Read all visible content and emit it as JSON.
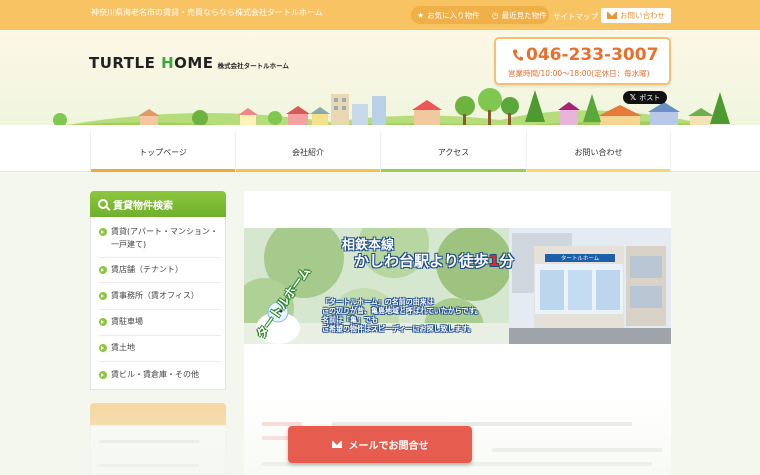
{
  "topbar": {
    "tagline": "神奈川県海老名市の賃貸・売買ならなら株式会社タートルホーム",
    "favorites_label": "お気に入り物件",
    "recent_label": "最近見た物件",
    "sitemap_label": "サイトマップ",
    "contact_label": "お問い合わせ"
  },
  "header": {
    "logo_main_a": "TURTLE ",
    "logo_main_h": "H",
    "logo_main_b": "OME",
    "logo_sub": "株式会社タートルホーム",
    "phone": "046-233-3007",
    "hours": "営業時間/10:00～18:00(定休日：毎水曜)",
    "x_post": "ポスト"
  },
  "nav": {
    "items": [
      {
        "label": "トップページ",
        "color": "#f0a93a"
      },
      {
        "label": "会社紹介",
        "color": "#f3c34a"
      },
      {
        "label": "アクセス",
        "color": "#9bcf4a"
      },
      {
        "label": "お問い合わせ",
        "color": "#f5d76a"
      }
    ]
  },
  "sidebar": {
    "title": "賃貸物件検索",
    "items": [
      {
        "label": "賃貸(アパート・マンション・一戸建て)"
      },
      {
        "label": "賃店舗（テナント）"
      },
      {
        "label": "賃事務所（賃オフィス）"
      },
      {
        "label": "賃駐車場"
      },
      {
        "label": "賃土地"
      },
      {
        "label": "賃ビル・賃倉庫・その他"
      }
    ]
  },
  "banner": {
    "title_line1": "相鉄本線",
    "title_line2_a": "かしわ台駅より徒歩",
    "title_line2_num": "1",
    "title_line2_b": "分",
    "side_text": "タートルホーム",
    "body_line1": "「タートルホーム」の名前の由来は",
    "body_line2": "この辺りが昔、亀島地域と呼ばれていたからです。",
    "body_line3": "名前は「亀」でも",
    "body_line4": "ご希望の物件はスピーディーにお探し致します。",
    "sign_text": "タートルホーム"
  },
  "float_button": {
    "label": "メールでお問合せ"
  },
  "colors": {
    "topbar": "#f8c363",
    "accent_green": "#8dc63f",
    "phone_orange": "#e8702d",
    "mail_button": "#e65d50"
  }
}
